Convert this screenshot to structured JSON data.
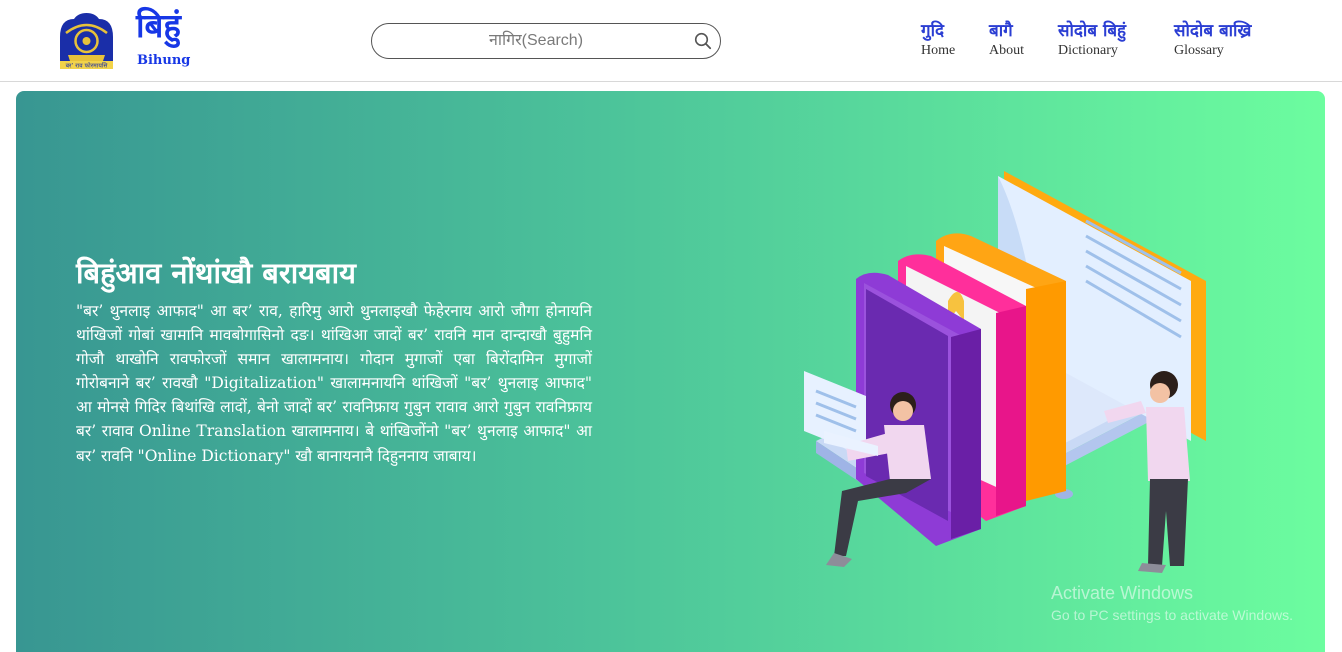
{
  "header": {
    "brand": {
      "name": "बिहुं",
      "sub": "Bihung",
      "emblem_text": "बर’ राव फोरमायसि"
    },
    "search": {
      "placeholder": "नागिर(Search)"
    },
    "nav": [
      {
        "main": "गुदि",
        "sub": "Home"
      },
      {
        "main": "बागै",
        "sub": "About"
      },
      {
        "main": "सोदोब बिहुं",
        "sub": "Dictionary"
      },
      {
        "main": "सोदोब बाख्रि",
        "sub": "Glossary"
      }
    ]
  },
  "hero": {
    "title": "बिहुंआव नोंथांखौ बरायबाय",
    "body": "\"बर’ थुनलाइ आफाद\" आ बर’ राव, हारिमु आरो थुनलाइखौ फेहेरनाय आरो जौगा होनायनि थांखिजों गोबां खामानि मावबोगासिनो दङ। थांखिआ जादों बर’ रावनि मान दान्दाखौ बुहुमनि गोजौ थाखोनि रावफोरजों समान खालामनाय। गोदान मुगाजों एबा बिरोंदामिन मुगाजों गोरोबनाने बर’ रावखौ \"Digitalization\" खालामनायनि थांखिजों \"बर’ थुनलाइ आफाद\" आ मोनसे गिदिर बिथांखि लादों, बेनो जादों बर’ रावनिफ्राय गुबुन रावाव आरो गुबुन रावनिफ्राय बर’ रावाव Online Translation खालामनाय। बे थांखिजोंनो \"बर’ थुनलाइ आफाद\" आ बर’ रावनि \"Online Dictionary\" खौ बानायनानै दिहुननाय जाबाय।"
  },
  "watermark": {
    "title": "Activate Windows",
    "subtitle": "Go to PC settings to activate Windows."
  },
  "colors": {
    "brand_blue": "#1737e6",
    "nav_blue": "#2b3ed3",
    "hero_gradient_start": "#389692",
    "hero_gradient_end": "#6cfd9f"
  }
}
